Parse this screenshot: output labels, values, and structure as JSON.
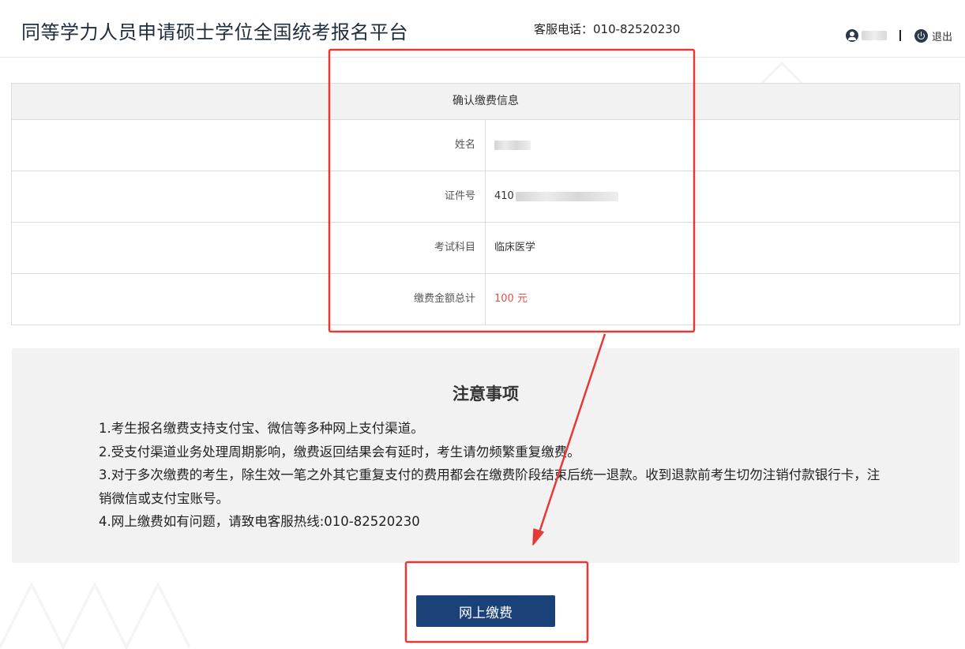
{
  "header": {
    "title": "同等学力人员申请硕士学位全国统考报名平台",
    "hotline": "客服电话：010-82520230",
    "logout_label": "退出"
  },
  "payment_info": {
    "heading": "确认缴费信息",
    "rows": [
      {
        "label": "姓名",
        "value": ""
      },
      {
        "label": "证件号",
        "value": "410"
      },
      {
        "label": "考试科目",
        "value": "临床医学"
      },
      {
        "label": "缴费金额总计",
        "value": "100 元"
      }
    ]
  },
  "notice": {
    "title": "注意事项",
    "items": [
      "1.考生报名缴费支持支付宝、微信等多种网上支付渠道。",
      "2.受支付渠道业务处理周期影响，缴费返回结果会有延时，考生请勿频繁重复缴费。",
      "3.对于多次缴费的考生，除生效一笔之外其它重复支付的费用都会在缴费阶段结束后统一退款。收到退款前考生切勿注销付款银行卡，注销微信或支付宝账号。",
      "4.网上缴费如有问题，请致电客服热线:010-82520230"
    ]
  },
  "pay_button_label": "网上缴费",
  "colors": {
    "primary_button": "#1a4178",
    "amount_text": "#d9534f",
    "annotation": "#e53935"
  },
  "icons": [
    "user-icon",
    "logout-icon"
  ]
}
